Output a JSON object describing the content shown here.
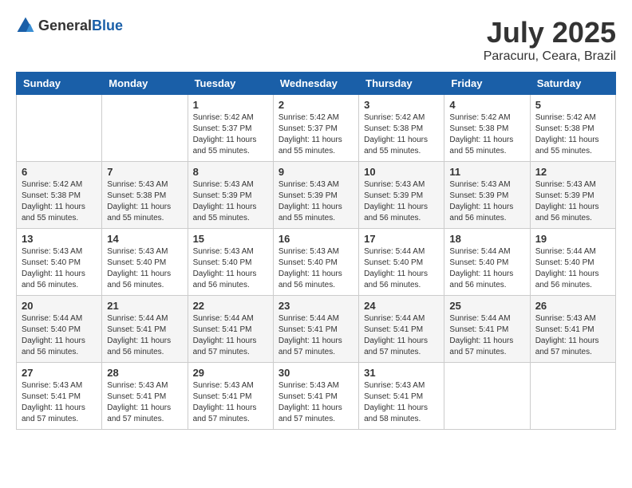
{
  "header": {
    "logo_general": "General",
    "logo_blue": "Blue",
    "month_title": "July 2025",
    "location": "Paracuru, Ceara, Brazil"
  },
  "weekdays": [
    "Sunday",
    "Monday",
    "Tuesday",
    "Wednesday",
    "Thursday",
    "Friday",
    "Saturday"
  ],
  "weeks": [
    [
      {
        "day": "",
        "info": ""
      },
      {
        "day": "",
        "info": ""
      },
      {
        "day": "1",
        "info": "Sunrise: 5:42 AM\nSunset: 5:37 PM\nDaylight: 11 hours and 55 minutes."
      },
      {
        "day": "2",
        "info": "Sunrise: 5:42 AM\nSunset: 5:37 PM\nDaylight: 11 hours and 55 minutes."
      },
      {
        "day": "3",
        "info": "Sunrise: 5:42 AM\nSunset: 5:38 PM\nDaylight: 11 hours and 55 minutes."
      },
      {
        "day": "4",
        "info": "Sunrise: 5:42 AM\nSunset: 5:38 PM\nDaylight: 11 hours and 55 minutes."
      },
      {
        "day": "5",
        "info": "Sunrise: 5:42 AM\nSunset: 5:38 PM\nDaylight: 11 hours and 55 minutes."
      }
    ],
    [
      {
        "day": "6",
        "info": "Sunrise: 5:42 AM\nSunset: 5:38 PM\nDaylight: 11 hours and 55 minutes."
      },
      {
        "day": "7",
        "info": "Sunrise: 5:43 AM\nSunset: 5:38 PM\nDaylight: 11 hours and 55 minutes."
      },
      {
        "day": "8",
        "info": "Sunrise: 5:43 AM\nSunset: 5:39 PM\nDaylight: 11 hours and 55 minutes."
      },
      {
        "day": "9",
        "info": "Sunrise: 5:43 AM\nSunset: 5:39 PM\nDaylight: 11 hours and 55 minutes."
      },
      {
        "day": "10",
        "info": "Sunrise: 5:43 AM\nSunset: 5:39 PM\nDaylight: 11 hours and 56 minutes."
      },
      {
        "day": "11",
        "info": "Sunrise: 5:43 AM\nSunset: 5:39 PM\nDaylight: 11 hours and 56 minutes."
      },
      {
        "day": "12",
        "info": "Sunrise: 5:43 AM\nSunset: 5:39 PM\nDaylight: 11 hours and 56 minutes."
      }
    ],
    [
      {
        "day": "13",
        "info": "Sunrise: 5:43 AM\nSunset: 5:40 PM\nDaylight: 11 hours and 56 minutes."
      },
      {
        "day": "14",
        "info": "Sunrise: 5:43 AM\nSunset: 5:40 PM\nDaylight: 11 hours and 56 minutes."
      },
      {
        "day": "15",
        "info": "Sunrise: 5:43 AM\nSunset: 5:40 PM\nDaylight: 11 hours and 56 minutes."
      },
      {
        "day": "16",
        "info": "Sunrise: 5:43 AM\nSunset: 5:40 PM\nDaylight: 11 hours and 56 minutes."
      },
      {
        "day": "17",
        "info": "Sunrise: 5:44 AM\nSunset: 5:40 PM\nDaylight: 11 hours and 56 minutes."
      },
      {
        "day": "18",
        "info": "Sunrise: 5:44 AM\nSunset: 5:40 PM\nDaylight: 11 hours and 56 minutes."
      },
      {
        "day": "19",
        "info": "Sunrise: 5:44 AM\nSunset: 5:40 PM\nDaylight: 11 hours and 56 minutes."
      }
    ],
    [
      {
        "day": "20",
        "info": "Sunrise: 5:44 AM\nSunset: 5:40 PM\nDaylight: 11 hours and 56 minutes."
      },
      {
        "day": "21",
        "info": "Sunrise: 5:44 AM\nSunset: 5:41 PM\nDaylight: 11 hours and 56 minutes."
      },
      {
        "day": "22",
        "info": "Sunrise: 5:44 AM\nSunset: 5:41 PM\nDaylight: 11 hours and 57 minutes."
      },
      {
        "day": "23",
        "info": "Sunrise: 5:44 AM\nSunset: 5:41 PM\nDaylight: 11 hours and 57 minutes."
      },
      {
        "day": "24",
        "info": "Sunrise: 5:44 AM\nSunset: 5:41 PM\nDaylight: 11 hours and 57 minutes."
      },
      {
        "day": "25",
        "info": "Sunrise: 5:44 AM\nSunset: 5:41 PM\nDaylight: 11 hours and 57 minutes."
      },
      {
        "day": "26",
        "info": "Sunrise: 5:43 AM\nSunset: 5:41 PM\nDaylight: 11 hours and 57 minutes."
      }
    ],
    [
      {
        "day": "27",
        "info": "Sunrise: 5:43 AM\nSunset: 5:41 PM\nDaylight: 11 hours and 57 minutes."
      },
      {
        "day": "28",
        "info": "Sunrise: 5:43 AM\nSunset: 5:41 PM\nDaylight: 11 hours and 57 minutes."
      },
      {
        "day": "29",
        "info": "Sunrise: 5:43 AM\nSunset: 5:41 PM\nDaylight: 11 hours and 57 minutes."
      },
      {
        "day": "30",
        "info": "Sunrise: 5:43 AM\nSunset: 5:41 PM\nDaylight: 11 hours and 57 minutes."
      },
      {
        "day": "31",
        "info": "Sunrise: 5:43 AM\nSunset: 5:41 PM\nDaylight: 11 hours and 58 minutes."
      },
      {
        "day": "",
        "info": ""
      },
      {
        "day": "",
        "info": ""
      }
    ]
  ]
}
